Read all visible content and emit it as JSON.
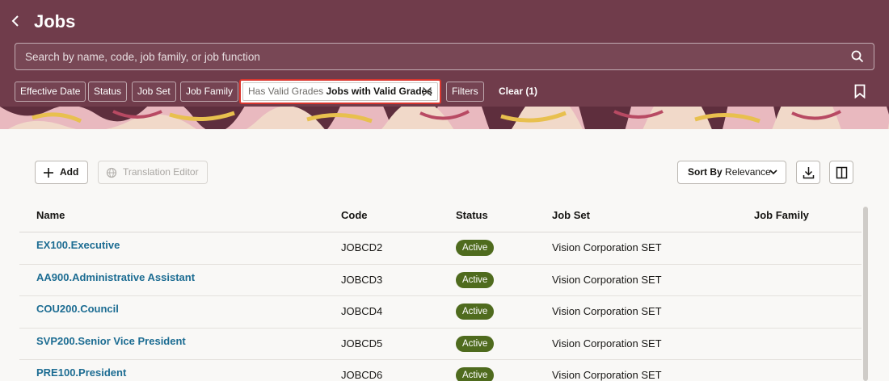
{
  "header": {
    "title": "Jobs",
    "search_placeholder": "Search by name, code, job family, or job function",
    "filters": [
      {
        "label": "Effective Date"
      },
      {
        "label": "Status"
      },
      {
        "label": "Job Set"
      },
      {
        "label": "Job Family"
      }
    ],
    "active_filter": {
      "label": "Has Valid Grades",
      "value": "Jobs with Valid Grades"
    },
    "filters_button": "Filters",
    "clear_label": "Clear (1)"
  },
  "toolbar": {
    "add_label": "Add",
    "translation_label": "Translation Editor",
    "sort_prefix": "Sort By",
    "sort_value": "Relevance"
  },
  "table": {
    "headers": [
      "Name",
      "Code",
      "Status",
      "Job Set",
      "Job Family"
    ],
    "rows": [
      {
        "name": "EX100.Executive",
        "code": "JOBCD2",
        "status": "Active",
        "job_set": "Vision Corporation SET"
      },
      {
        "name": "AA900.Administrative Assistant",
        "code": "JOBCD3",
        "status": "Active",
        "job_set": "Vision Corporation SET"
      },
      {
        "name": "COU200.Council",
        "code": "JOBCD4",
        "status": "Active",
        "job_set": "Vision Corporation SET"
      },
      {
        "name": "SVP200.Senior Vice President",
        "code": "JOBCD5",
        "status": "Active",
        "job_set": "Vision Corporation SET"
      },
      {
        "name": "PRE100.President",
        "code": "JOBCD6",
        "status": "Active",
        "job_set": "Vision Corporation SET"
      }
    ]
  },
  "colors": {
    "header_bg": "#703c4b",
    "link": "#1c6c92",
    "badge_active": "#4f6b1e",
    "highlight": "#d9372f"
  },
  "icons": [
    "back-icon",
    "search-icon",
    "close-icon",
    "bookmark-icon",
    "plus-icon",
    "globe-icon",
    "chevron-down-icon",
    "download-icon",
    "columns-icon"
  ]
}
